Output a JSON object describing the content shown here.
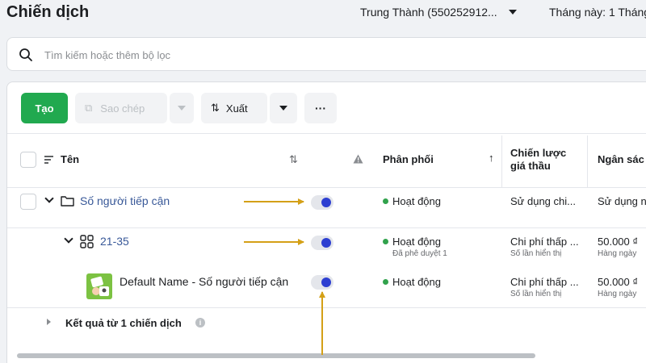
{
  "header": {
    "title": "Chiến dịch",
    "account": "Trung Thành (550252912...",
    "date_range": "Tháng này: 1 Tháng"
  },
  "search": {
    "placeholder": "Tìm kiếm hoặc thêm bộ lọc"
  },
  "toolbar": {
    "create_label": "Tạo",
    "copy_label": "Sao chép",
    "export_label": "Xuất",
    "more_label": "···"
  },
  "table": {
    "columns": {
      "name": "Tên",
      "delivery": "Phân phối",
      "bid_strategy_line1": "Chiến lược",
      "bid_strategy_line2": "giá thầu",
      "budget": "Ngân sác"
    },
    "rows": [
      {
        "name": "Số người tiếp cận",
        "delivery": "Hoạt động",
        "delivery_sub": "",
        "bid_strategy": "Sử dụng chi...",
        "bid_strategy_sub": "",
        "budget": "Sử dụng n",
        "budget_sub": "",
        "toggle_on": true
      },
      {
        "name": "21-35",
        "delivery": "Hoạt động",
        "delivery_sub": "Đã phê duyệt 1",
        "bid_strategy": "Chi phí thấp ...",
        "bid_strategy_sub": "Số lần hiển thị",
        "budget": "50.000 ₫",
        "budget_sub": "Hàng ngày",
        "toggle_on": true
      },
      {
        "name": "Default Name - Số người tiếp cận",
        "delivery": "Hoạt động",
        "delivery_sub": "",
        "bid_strategy": "Chi phí thấp ...",
        "bid_strategy_sub": "Số lần hiển thị",
        "budget": "50.000 ₫",
        "budget_sub": "Hàng ngày",
        "toggle_on": true
      }
    ],
    "summary": "Kết quả từ 1 chiến dịch"
  },
  "colors": {
    "accent_green": "#21a94f",
    "toggle_knob": "#2d3fd1",
    "status_dot": "#31a24c",
    "link": "#385898",
    "annotation_arrow": "#d4a017"
  },
  "icons": {
    "search": "search-icon",
    "copy": "copy-icon",
    "export": "export-icon",
    "sort": "sort-icon",
    "warning": "warning-icon",
    "folder": "folder-icon",
    "adset": "grid-icon",
    "ad_thumb": "ad-thumbnail-icon",
    "info": "info-icon"
  }
}
